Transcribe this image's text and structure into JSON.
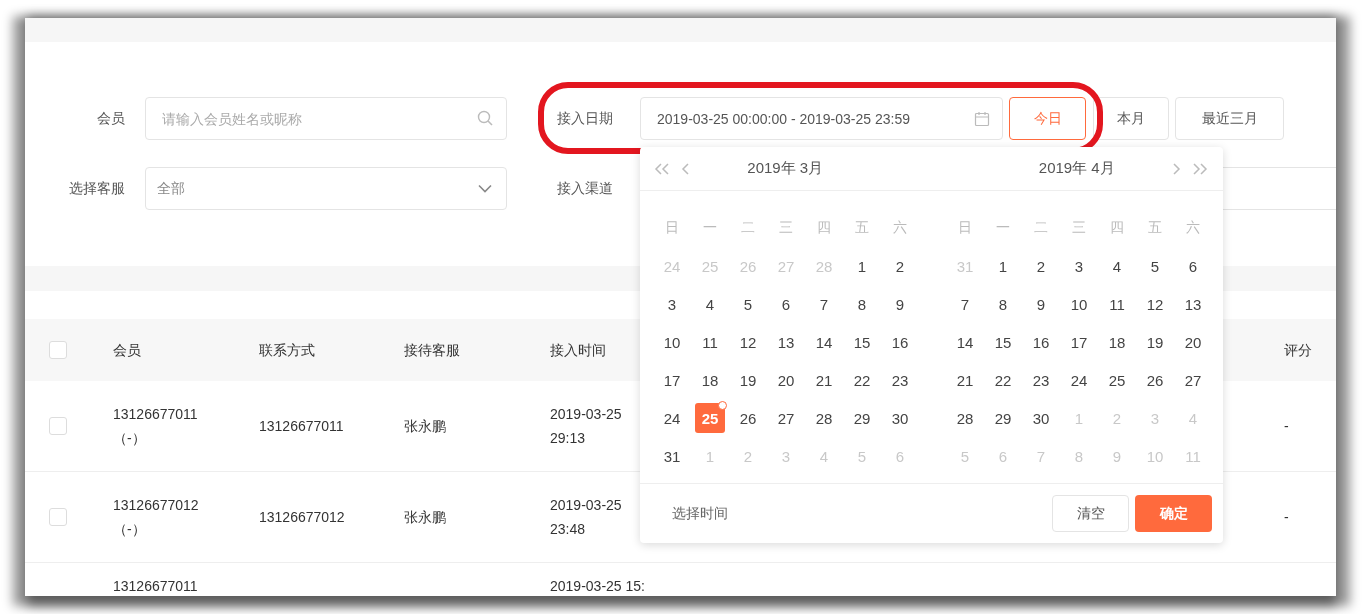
{
  "filters": {
    "member": {
      "label": "会员",
      "placeholder": "请输入会员姓名或昵称"
    },
    "date": {
      "label": "接入日期",
      "value": "2019-03-25 00:00:00 - 2019-03-25 23:59",
      "highlighted": true
    },
    "quick_ranges": [
      {
        "label": "今日",
        "selected": true
      },
      {
        "label": "本月",
        "selected": false
      },
      {
        "label": "最近三月",
        "selected": false
      }
    ],
    "agent": {
      "label": "选择客服",
      "value": "全部"
    },
    "channel": {
      "label": "接入渠道"
    }
  },
  "table": {
    "header_checked": false,
    "columns": [
      "会员",
      "联系方式",
      "接待客服",
      "接入时间",
      "评分"
    ],
    "rows": [
      {
        "checked": false,
        "member": "13126677011",
        "member_note": "（-）",
        "contact": "13126677011",
        "agent": "张永鹏",
        "time": [
          "2019-03-25",
          "29:13"
        ],
        "rating": "-"
      },
      {
        "checked": false,
        "member": "13126677012",
        "member_note": "（-）",
        "contact": "13126677012",
        "agent": "张永鹏",
        "time": [
          "2019-03-25",
          "23:48"
        ],
        "rating": "-"
      },
      {
        "member": "13126677011",
        "time": [
          "2019-03-25 15:"
        ]
      }
    ]
  },
  "date_picker": {
    "months": [
      {
        "title": "2019年 3月",
        "weekdays": [
          "日",
          "一",
          "二",
          "三",
          "四",
          "五",
          "六"
        ],
        "weeks": [
          [
            {
              "d": "24",
              "outside": true,
              "selected": false
            },
            {
              "d": "25",
              "outside": true,
              "selected": false
            },
            {
              "d": "26",
              "outside": true,
              "selected": false
            },
            {
              "d": "27",
              "outside": true,
              "selected": false
            },
            {
              "d": "28",
              "outside": true,
              "selected": false
            },
            {
              "d": "1",
              "outside": false,
              "selected": false
            },
            {
              "d": "2",
              "outside": false,
              "selected": false
            }
          ],
          [
            {
              "d": "3",
              "outside": false,
              "selected": false
            },
            {
              "d": "4",
              "outside": false,
              "selected": false
            },
            {
              "d": "5",
              "outside": false,
              "selected": false
            },
            {
              "d": "6",
              "outside": false,
              "selected": false
            },
            {
              "d": "7",
              "outside": false,
              "selected": false
            },
            {
              "d": "8",
              "outside": false,
              "selected": false
            },
            {
              "d": "9",
              "outside": false,
              "selected": false
            }
          ],
          [
            {
              "d": "10",
              "outside": false,
              "selected": false
            },
            {
              "d": "11",
              "outside": false,
              "selected": false
            },
            {
              "d": "12",
              "outside": false,
              "selected": false
            },
            {
              "d": "13",
              "outside": false,
              "selected": false
            },
            {
              "d": "14",
              "outside": false,
              "selected": false
            },
            {
              "d": "15",
              "outside": false,
              "selected": false
            },
            {
              "d": "16",
              "outside": false,
              "selected": false
            }
          ],
          [
            {
              "d": "17",
              "outside": false,
              "selected": false
            },
            {
              "d": "18",
              "outside": false,
              "selected": false
            },
            {
              "d": "19",
              "outside": false,
              "selected": false
            },
            {
              "d": "20",
              "outside": false,
              "selected": false
            },
            {
              "d": "21",
              "outside": false,
              "selected": false
            },
            {
              "d": "22",
              "outside": false,
              "selected": false
            },
            {
              "d": "23",
              "outside": false,
              "selected": false
            }
          ],
          [
            {
              "d": "24",
              "outside": false,
              "selected": false
            },
            {
              "d": "25",
              "outside": false,
              "selected": true
            },
            {
              "d": "26",
              "outside": false,
              "selected": false
            },
            {
              "d": "27",
              "outside": false,
              "selected": false
            },
            {
              "d": "28",
              "outside": false,
              "selected": false
            },
            {
              "d": "29",
              "outside": false,
              "selected": false
            },
            {
              "d": "30",
              "outside": false,
              "selected": false
            }
          ],
          [
            {
              "d": "31",
              "outside": false,
              "selected": false
            },
            {
              "d": "1",
              "outside": true,
              "selected": false
            },
            {
              "d": "2",
              "outside": true,
              "selected": false
            },
            {
              "d": "3",
              "outside": true,
              "selected": false
            },
            {
              "d": "4",
              "outside": true,
              "selected": false
            },
            {
              "d": "5",
              "outside": true,
              "selected": false
            },
            {
              "d": "6",
              "outside": true,
              "selected": false
            }
          ]
        ]
      },
      {
        "title": "2019年 4月",
        "weekdays": [
          "日",
          "一",
          "二",
          "三",
          "四",
          "五",
          "六"
        ],
        "weeks": [
          [
            {
              "d": "31",
              "outside": true,
              "selected": false
            },
            {
              "d": "1",
              "outside": false,
              "selected": false
            },
            {
              "d": "2",
              "outside": false,
              "selected": false
            },
            {
              "d": "3",
              "outside": false,
              "selected": false
            },
            {
              "d": "4",
              "outside": false,
              "selected": false
            },
            {
              "d": "5",
              "outside": false,
              "selected": false
            },
            {
              "d": "6",
              "outside": false,
              "selected": false
            }
          ],
          [
            {
              "d": "7",
              "outside": false,
              "selected": false
            },
            {
              "d": "8",
              "outside": false,
              "selected": false
            },
            {
              "d": "9",
              "outside": false,
              "selected": false
            },
            {
              "d": "10",
              "outside": false,
              "selected": false
            },
            {
              "d": "11",
              "outside": false,
              "selected": false
            },
            {
              "d": "12",
              "outside": false,
              "selected": false
            },
            {
              "d": "13",
              "outside": false,
              "selected": false
            }
          ],
          [
            {
              "d": "14",
              "outside": false,
              "selected": false
            },
            {
              "d": "15",
              "outside": false,
              "selected": false
            },
            {
              "d": "16",
              "outside": false,
              "selected": false
            },
            {
              "d": "17",
              "outside": false,
              "selected": false
            },
            {
              "d": "18",
              "outside": false,
              "selected": false
            },
            {
              "d": "19",
              "outside": false,
              "selected": false
            },
            {
              "d": "20",
              "outside": false,
              "selected": false
            }
          ],
          [
            {
              "d": "21",
              "outside": false,
              "selected": false
            },
            {
              "d": "22",
              "outside": false,
              "selected": false
            },
            {
              "d": "23",
              "outside": false,
              "selected": false
            },
            {
              "d": "24",
              "outside": false,
              "selected": false
            },
            {
              "d": "25",
              "outside": false,
              "selected": false
            },
            {
              "d": "26",
              "outside": false,
              "selected": false
            },
            {
              "d": "27",
              "outside": false,
              "selected": false
            }
          ],
          [
            {
              "d": "28",
              "outside": false,
              "selected": false
            },
            {
              "d": "29",
              "outside": false,
              "selected": false
            },
            {
              "d": "30",
              "outside": false,
              "selected": false
            },
            {
              "d": "1",
              "outside": true,
              "selected": false
            },
            {
              "d": "2",
              "outside": true,
              "selected": false
            },
            {
              "d": "3",
              "outside": true,
              "selected": false
            },
            {
              "d": "4",
              "outside": true,
              "selected": false
            }
          ],
          [
            {
              "d": "5",
              "outside": true,
              "selected": false
            },
            {
              "d": "6",
              "outside": true,
              "selected": false
            },
            {
              "d": "7",
              "outside": true,
              "selected": false
            },
            {
              "d": "8",
              "outside": true,
              "selected": false
            },
            {
              "d": "9",
              "outside": true,
              "selected": false
            },
            {
              "d": "10",
              "outside": true,
              "selected": false
            },
            {
              "d": "11",
              "outside": true,
              "selected": false
            }
          ]
        ]
      }
    ],
    "footer_link": "选择时间",
    "buttons": [
      {
        "label": "清空",
        "kind": "plain"
      },
      {
        "label": "确定",
        "kind": "primary"
      }
    ]
  }
}
